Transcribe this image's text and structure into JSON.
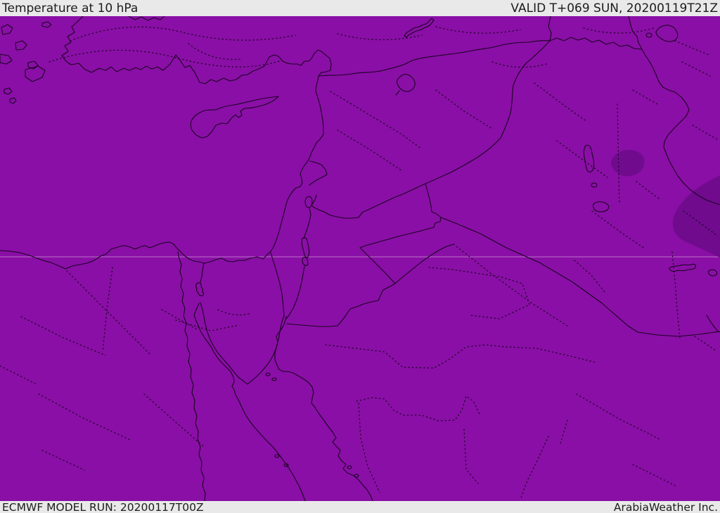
{
  "header": {
    "title": "Temperature at 10 hPa",
    "valid_label": "VALID T+069 SUN, 20200119T21Z"
  },
  "footer": {
    "model_run_label": "ECMWF MODEL RUN: 20200117T00Z",
    "credit_label": "ArabiaWeather Inc."
  },
  "map": {
    "parameter": "Temperature at 10 hPa",
    "colors": {
      "field_base": "#8A0FA6",
      "field_cold_patch": "#700B8E",
      "line": "#1B0322",
      "latitude_gridline": "#EFD5EF",
      "bar_background": "#E9E9E9",
      "bar_text": "#1C1C1C"
    }
  }
}
